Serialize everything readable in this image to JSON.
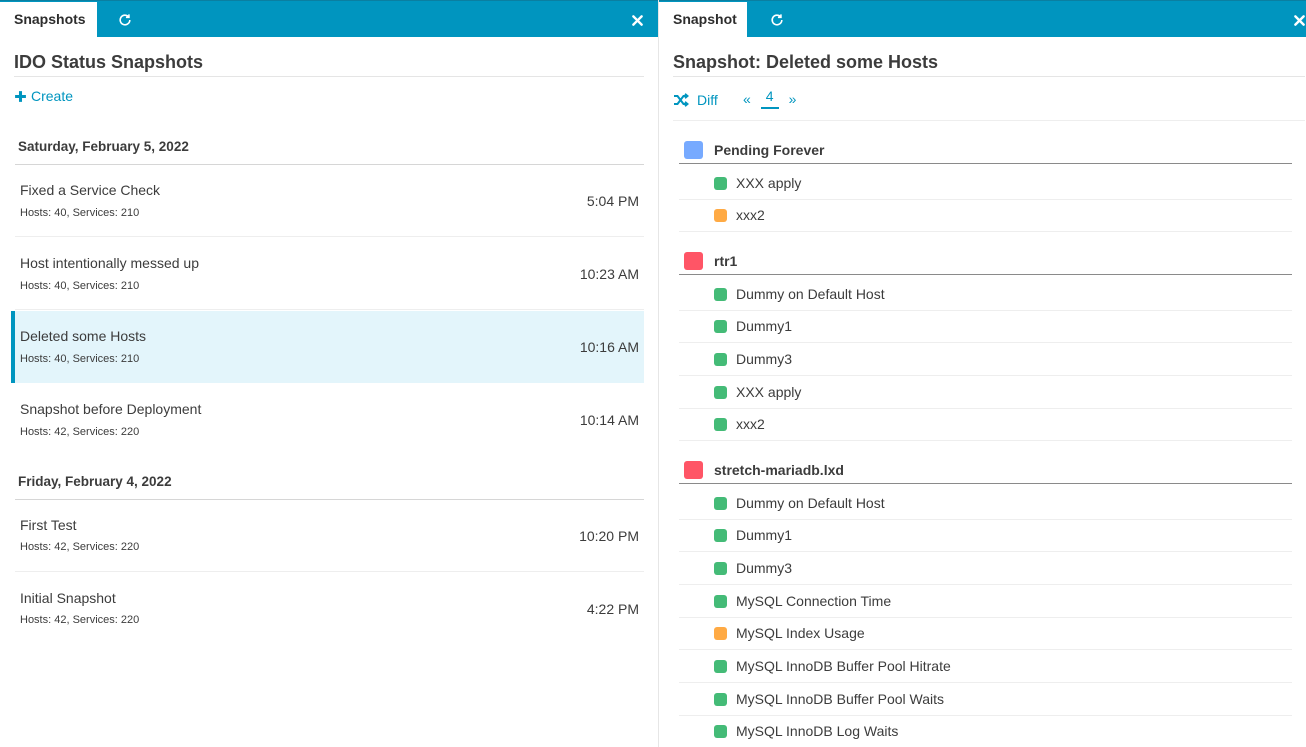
{
  "colors": {
    "accent": "#0095bf",
    "ok": "#44bb77",
    "warning": "#ffaa44",
    "critical": "#ff5566",
    "pending": "#77aaff",
    "active_row_bg": "#e3f5fb"
  },
  "left": {
    "tab_label": "Snapshots",
    "refresh_icon": "refresh-icon",
    "close_icon": "close-icon",
    "title": "IDO Status Snapshots",
    "create_label": "Create",
    "days": [
      {
        "label": "Saturday, February 5, 2022",
        "items": [
          {
            "name": "Fixed a Service Check",
            "meta": "Hosts: 40, Services: 210",
            "time": "5:04 PM"
          },
          {
            "name": "Host intentionally messed up",
            "meta": "Hosts: 40, Services: 210",
            "time": "10:23 AM"
          },
          {
            "name": "Deleted some Hosts",
            "meta": "Hosts: 40, Services: 210",
            "time": "10:16 AM"
          },
          {
            "name": "Snapshot before Deployment",
            "meta": "Hosts: 42, Services: 220",
            "time": "10:14 AM"
          }
        ]
      },
      {
        "label": "Friday, February 4, 2022",
        "items": [
          {
            "name": "First Test",
            "meta": "Hosts: 42, Services: 220",
            "time": "10:20 PM"
          },
          {
            "name": "Initial Snapshot",
            "meta": "Hosts: 42, Services: 220",
            "time": "4:22 PM"
          }
        ]
      }
    ]
  },
  "right": {
    "tab_label": "Snapshot",
    "title": "Snapshot: Deleted some Hosts",
    "diff_label": "Diff",
    "pager": {
      "prev": "«",
      "current": "4",
      "next": "»"
    },
    "groups": [
      {
        "name": "Pending Forever",
        "state": "pending",
        "services": [
          {
            "name": "XXX apply",
            "state": "ok"
          },
          {
            "name": "xxx2",
            "state": "warning"
          }
        ]
      },
      {
        "name": "rtr1",
        "state": "critical",
        "services": [
          {
            "name": "Dummy on Default Host",
            "state": "ok"
          },
          {
            "name": "Dummy1",
            "state": "ok"
          },
          {
            "name": "Dummy3",
            "state": "ok"
          },
          {
            "name": "XXX apply",
            "state": "ok"
          },
          {
            "name": "xxx2",
            "state": "ok"
          }
        ]
      },
      {
        "name": "stretch-mariadb.lxd",
        "state": "critical",
        "services": [
          {
            "name": "Dummy on Default Host",
            "state": "ok"
          },
          {
            "name": "Dummy1",
            "state": "ok"
          },
          {
            "name": "Dummy3",
            "state": "ok"
          },
          {
            "name": "MySQL Connection Time",
            "state": "ok"
          },
          {
            "name": "MySQL Index Usage",
            "state": "warning"
          },
          {
            "name": "MySQL InnoDB Buffer Pool Hitrate",
            "state": "ok"
          },
          {
            "name": "MySQL InnoDB Buffer Pool Waits",
            "state": "ok"
          },
          {
            "name": "MySQL InnoDB Log Waits",
            "state": "ok"
          }
        ]
      }
    ]
  }
}
